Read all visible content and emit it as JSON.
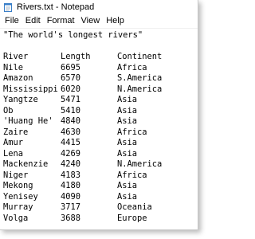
{
  "window": {
    "title": "Rivers.txt - Notepad",
    "icon": "notepad-icon"
  },
  "menu": [
    "File",
    "Edit",
    "Format",
    "View",
    "Help"
  ],
  "document": {
    "heading": "\"The world's longest rivers\"",
    "blank": "",
    "columns": [
      "River",
      "Length",
      "Continent"
    ],
    "rows": [
      [
        "Nile",
        "6695",
        "Africa"
      ],
      [
        "Amazon",
        "6570",
        "S.America"
      ],
      [
        "Mississippi",
        "6020",
        "N.America"
      ],
      [
        "Yangtze",
        "5471",
        "Asia"
      ],
      [
        "Ob",
        "5410",
        "Asia"
      ],
      [
        "'Huang He'",
        "4840",
        "Asia"
      ],
      [
        "Zaire",
        "4630",
        "Africa"
      ],
      [
        "Amur",
        "4415",
        "Asia"
      ],
      [
        "Lena",
        "4269",
        "Asia"
      ],
      [
        "Mackenzie",
        "4240",
        "N.America"
      ],
      [
        "Niger",
        "4183",
        "Africa"
      ],
      [
        "Mekong",
        "4180",
        "Asia"
      ],
      [
        "Yenisey",
        "4090",
        "Asia"
      ],
      [
        "Murray",
        "3717",
        "Oceania"
      ],
      [
        "Volga",
        "3688",
        "Europe"
      ]
    ]
  }
}
